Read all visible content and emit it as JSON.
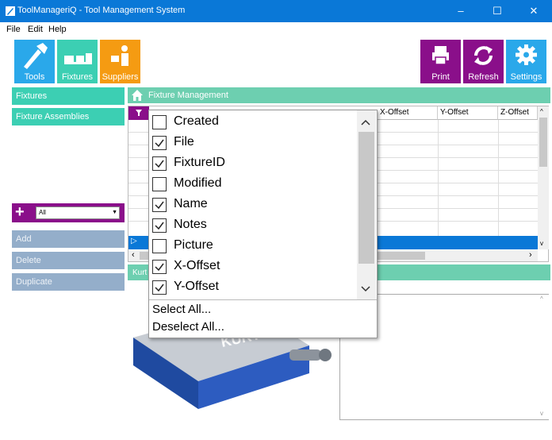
{
  "window": {
    "title": "ToolManageriQ - Tool Management System",
    "controls": {
      "minimize": "–",
      "maximize": "☐",
      "close": "✕"
    }
  },
  "menu": [
    "File",
    "Edit",
    "Help"
  ],
  "toolbar": {
    "tools": "Tools",
    "fixtures": "Fixtures",
    "suppliers": "Suppliers",
    "print": "Print",
    "refresh": "Refresh",
    "settings": "Settings"
  },
  "sidebar": {
    "items": [
      "Fixtures",
      "Fixture Assemblies"
    ],
    "filter_value": "All",
    "actions": [
      "Add",
      "Delete",
      "Duplicate"
    ]
  },
  "header": {
    "title": "Fixture Management"
  },
  "grid": {
    "columns": [
      "X-Offset",
      "Y-Offset",
      "Z-Offset"
    ]
  },
  "strip2": {
    "text": "Kurt"
  },
  "popup": {
    "options": [
      {
        "label": "Created",
        "checked": false
      },
      {
        "label": "File",
        "checked": true
      },
      {
        "label": "FixtureID",
        "checked": true
      },
      {
        "label": "Modified",
        "checked": false
      },
      {
        "label": "Name",
        "checked": true
      },
      {
        "label": "Notes",
        "checked": true
      },
      {
        "label": "Picture",
        "checked": false
      },
      {
        "label": "X-Offset",
        "checked": true
      },
      {
        "label": "Y-Offset",
        "checked": true
      }
    ],
    "select_all": "Select All...",
    "deselect_all": "Deselect All..."
  },
  "image": {
    "brand": "KURT"
  },
  "colors": {
    "titlebar": "#0a78d7",
    "teal": "#3ccfb3",
    "purple": "#8a0f8a",
    "sky": "#2aa8ea",
    "orange": "#f59b12"
  }
}
